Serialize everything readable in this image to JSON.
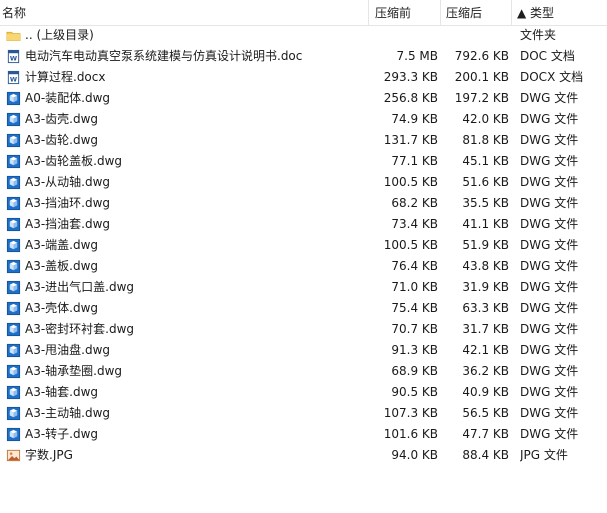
{
  "columns": {
    "name": "名称",
    "compressed": "压缩前",
    "original": "压缩后",
    "type": "▲ 类型"
  },
  "rows": [
    {
      "icon": "folder-icon",
      "name": ".. (上级目录)",
      "compressed": "",
      "original": "",
      "type": "文件夹"
    },
    {
      "icon": "word-doc-icon",
      "name": "电动汽车电动真空泵系统建模与仿真设计说明书.doc",
      "compressed": "7.5 MB",
      "original": "792.6 KB",
      "type": "DOC 文档"
    },
    {
      "icon": "word-doc-icon",
      "name": "计算过程.docx",
      "compressed": "293.3 KB",
      "original": "200.1 KB",
      "type": "DOCX 文档"
    },
    {
      "icon": "dwg-file-icon",
      "name": "A0-装配体.dwg",
      "compressed": "256.8 KB",
      "original": "197.2 KB",
      "type": "DWG 文件"
    },
    {
      "icon": "dwg-file-icon",
      "name": "A3-齿壳.dwg",
      "compressed": "74.9 KB",
      "original": "42.0 KB",
      "type": "DWG 文件"
    },
    {
      "icon": "dwg-file-icon",
      "name": "A3-齿轮.dwg",
      "compressed": "131.7 KB",
      "original": "81.8 KB",
      "type": "DWG 文件"
    },
    {
      "icon": "dwg-file-icon",
      "name": "A3-齿轮盖板.dwg",
      "compressed": "77.1 KB",
      "original": "45.1 KB",
      "type": "DWG 文件"
    },
    {
      "icon": "dwg-file-icon",
      "name": "A3-从动轴.dwg",
      "compressed": "100.5 KB",
      "original": "51.6 KB",
      "type": "DWG 文件"
    },
    {
      "icon": "dwg-file-icon",
      "name": "A3-挡油环.dwg",
      "compressed": "68.2 KB",
      "original": "35.5 KB",
      "type": "DWG 文件"
    },
    {
      "icon": "dwg-file-icon",
      "name": "A3-挡油套.dwg",
      "compressed": "73.4 KB",
      "original": "41.1 KB",
      "type": "DWG 文件"
    },
    {
      "icon": "dwg-file-icon",
      "name": "A3-端盖.dwg",
      "compressed": "100.5 KB",
      "original": "51.9 KB",
      "type": "DWG 文件"
    },
    {
      "icon": "dwg-file-icon",
      "name": "A3-盖板.dwg",
      "compressed": "76.4 KB",
      "original": "43.8 KB",
      "type": "DWG 文件"
    },
    {
      "icon": "dwg-file-icon",
      "name": "A3-进出气口盖.dwg",
      "compressed": "71.0 KB",
      "original": "31.9 KB",
      "type": "DWG 文件"
    },
    {
      "icon": "dwg-file-icon",
      "name": "A3-壳体.dwg",
      "compressed": "75.4 KB",
      "original": "63.3 KB",
      "type": "DWG 文件"
    },
    {
      "icon": "dwg-file-icon",
      "name": "A3-密封环衬套.dwg",
      "compressed": "70.7 KB",
      "original": "31.7 KB",
      "type": "DWG 文件"
    },
    {
      "icon": "dwg-file-icon",
      "name": "A3-甩油盘.dwg",
      "compressed": "91.3 KB",
      "original": "42.1 KB",
      "type": "DWG 文件"
    },
    {
      "icon": "dwg-file-icon",
      "name": "A3-轴承垫圈.dwg",
      "compressed": "68.9 KB",
      "original": "36.2 KB",
      "type": "DWG 文件"
    },
    {
      "icon": "dwg-file-icon",
      "name": "A3-轴套.dwg",
      "compressed": "90.5 KB",
      "original": "40.9 KB",
      "type": "DWG 文件"
    },
    {
      "icon": "dwg-file-icon",
      "name": "A3-主动轴.dwg",
      "compressed": "107.3 KB",
      "original": "56.5 KB",
      "type": "DWG 文件"
    },
    {
      "icon": "dwg-file-icon",
      "name": "A3-转子.dwg",
      "compressed": "101.6 KB",
      "original": "47.7 KB",
      "type": "DWG 文件"
    },
    {
      "icon": "jpg-image-icon",
      "name": "字数.JPG",
      "compressed": "94.0 KB",
      "original": "88.4 KB",
      "type": "JPG 文件"
    }
  ]
}
